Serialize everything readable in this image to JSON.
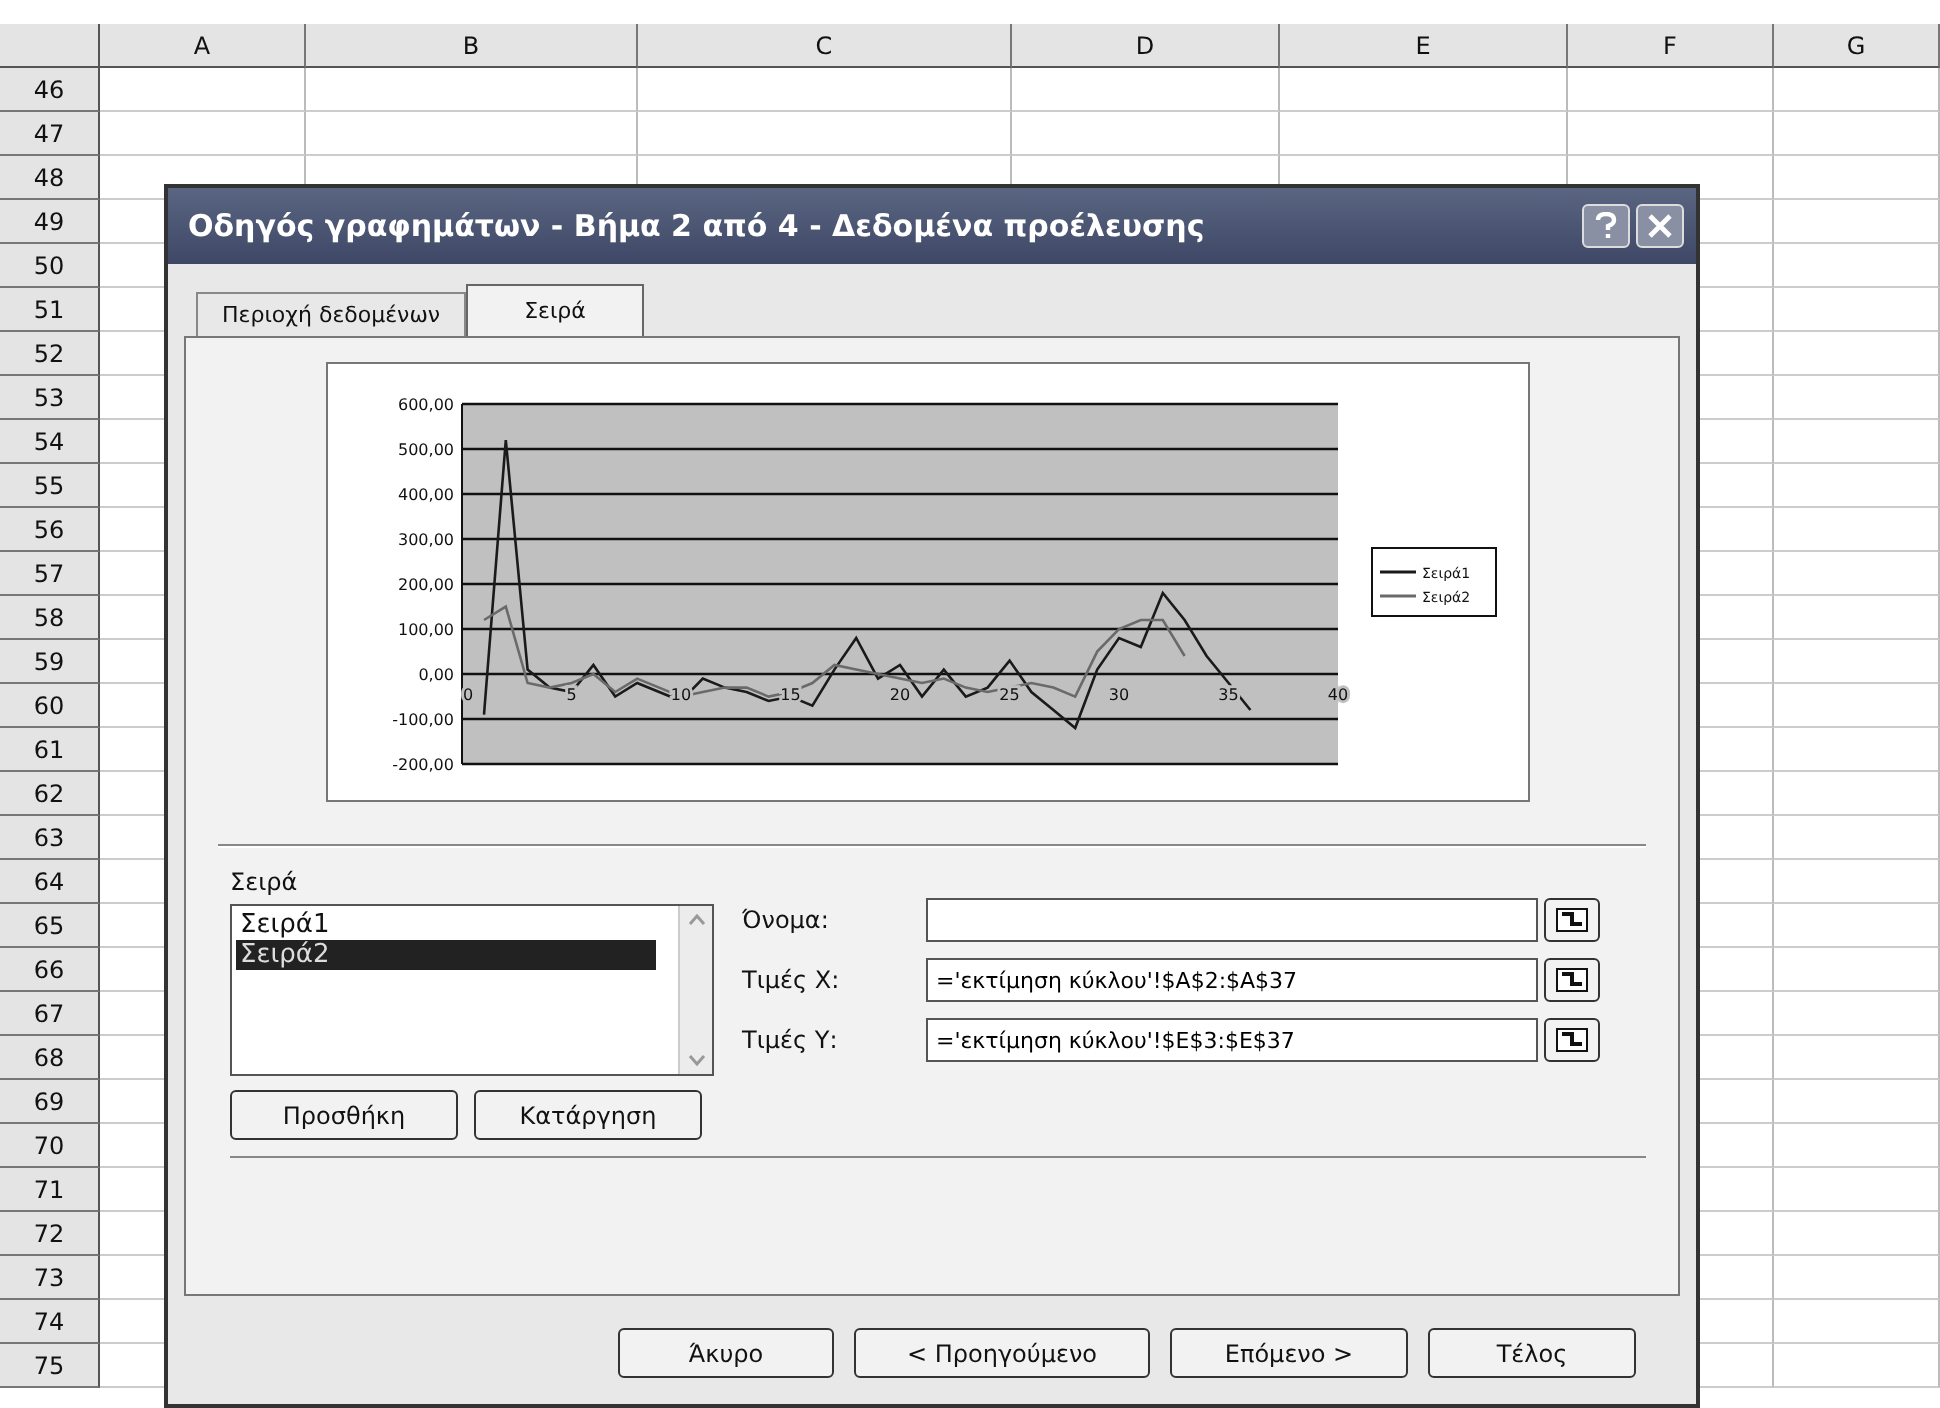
{
  "sheet": {
    "columns": [
      "A",
      "B",
      "C",
      "D",
      "E",
      "F",
      "G"
    ],
    "rows": [
      "46",
      "47",
      "48",
      "49",
      "50",
      "51",
      "52",
      "53",
      "54",
      "55",
      "56",
      "57",
      "58",
      "59",
      "60",
      "61",
      "62",
      "63",
      "64",
      "65",
      "66",
      "67",
      "68",
      "69",
      "70",
      "71",
      "72",
      "73",
      "74",
      "75"
    ]
  },
  "dialog": {
    "title": "Οδηγός γραφημάτων - Βήμα 2 από 4 - Δεδομένα προέλευσης",
    "tabs": [
      {
        "label": "Περιοχή δεδομένων",
        "selected": false
      },
      {
        "label": "Σειρά",
        "selected": true
      }
    ],
    "chart_data": {
      "type": "line",
      "x": [
        1,
        2,
        3,
        4,
        5,
        6,
        7,
        8,
        9,
        10,
        11,
        12,
        13,
        14,
        15,
        16,
        17,
        18,
        19,
        20,
        21,
        22,
        23,
        24,
        25,
        26,
        27,
        28,
        29,
        30,
        31,
        32,
        33,
        34,
        35,
        36
      ],
      "series": [
        {
          "name": "Σειρά1",
          "color": "#1a1a1a",
          "values": [
            -90,
            520,
            10,
            -30,
            -40,
            20,
            -50,
            -20,
            -40,
            -60,
            -10,
            -30,
            -40,
            -60,
            -50,
            -70,
            10,
            80,
            -10,
            20,
            -50,
            10,
            -50,
            -30,
            30,
            -40,
            -80,
            -120,
            10,
            80,
            60,
            180,
            120,
            40,
            -20,
            -80
          ]
        },
        {
          "name": "Σειρά2",
          "color": "#6a6a6a",
          "values": [
            120,
            150,
            -20,
            -30,
            -20,
            0,
            -40,
            -10,
            -30,
            -50,
            -40,
            -30,
            -30,
            -50,
            -40,
            -20,
            20,
            10,
            0,
            -10,
            -20,
            -10,
            -30,
            -40,
            -30,
            -20,
            -30,
            -50,
            50,
            100,
            120,
            120,
            40,
            null,
            null,
            null
          ]
        }
      ],
      "grid": true,
      "legend": true,
      "xlim": [
        0,
        40
      ],
      "ylim": [
        -200,
        600
      ],
      "xticks": [
        0,
        5,
        10,
        15,
        20,
        25,
        30,
        35,
        40
      ],
      "yticks": [
        {
          "value": 600,
          "label": "600,00"
        },
        {
          "value": 500,
          "label": "500,00"
        },
        {
          "value": 400,
          "label": "400,00"
        },
        {
          "value": 300,
          "label": "300,00"
        },
        {
          "value": 200,
          "label": "200,00"
        },
        {
          "value": 100,
          "label": "100,00"
        },
        {
          "value": 0,
          "label": "0,00"
        },
        {
          "value": -100,
          "label": "-100,00"
        },
        {
          "value": -200,
          "label": "-200,00"
        }
      ]
    },
    "series_list": {
      "label": "Σειρά",
      "items": [
        {
          "label": "Σειρά1",
          "selected": false
        },
        {
          "label": "Σειρά2",
          "selected": true
        }
      ],
      "buttons": [
        "Προσθήκη",
        "Κατάργηση"
      ]
    },
    "fields": [
      {
        "label": "Όνομα:"
      },
      {
        "label": "Τιμές Χ:",
        "value": "='εκτίμηση κύκλου'!$A$2:$A$37"
      },
      {
        "label": "Τιμές Υ:",
        "value": "='εκτίμηση κύκλου'!$E$3:$E$37"
      }
    ],
    "buttons": [
      "Άκυρο",
      "< Προηγούμενο",
      "Επόμενο >",
      "Τέλος"
    ]
  }
}
